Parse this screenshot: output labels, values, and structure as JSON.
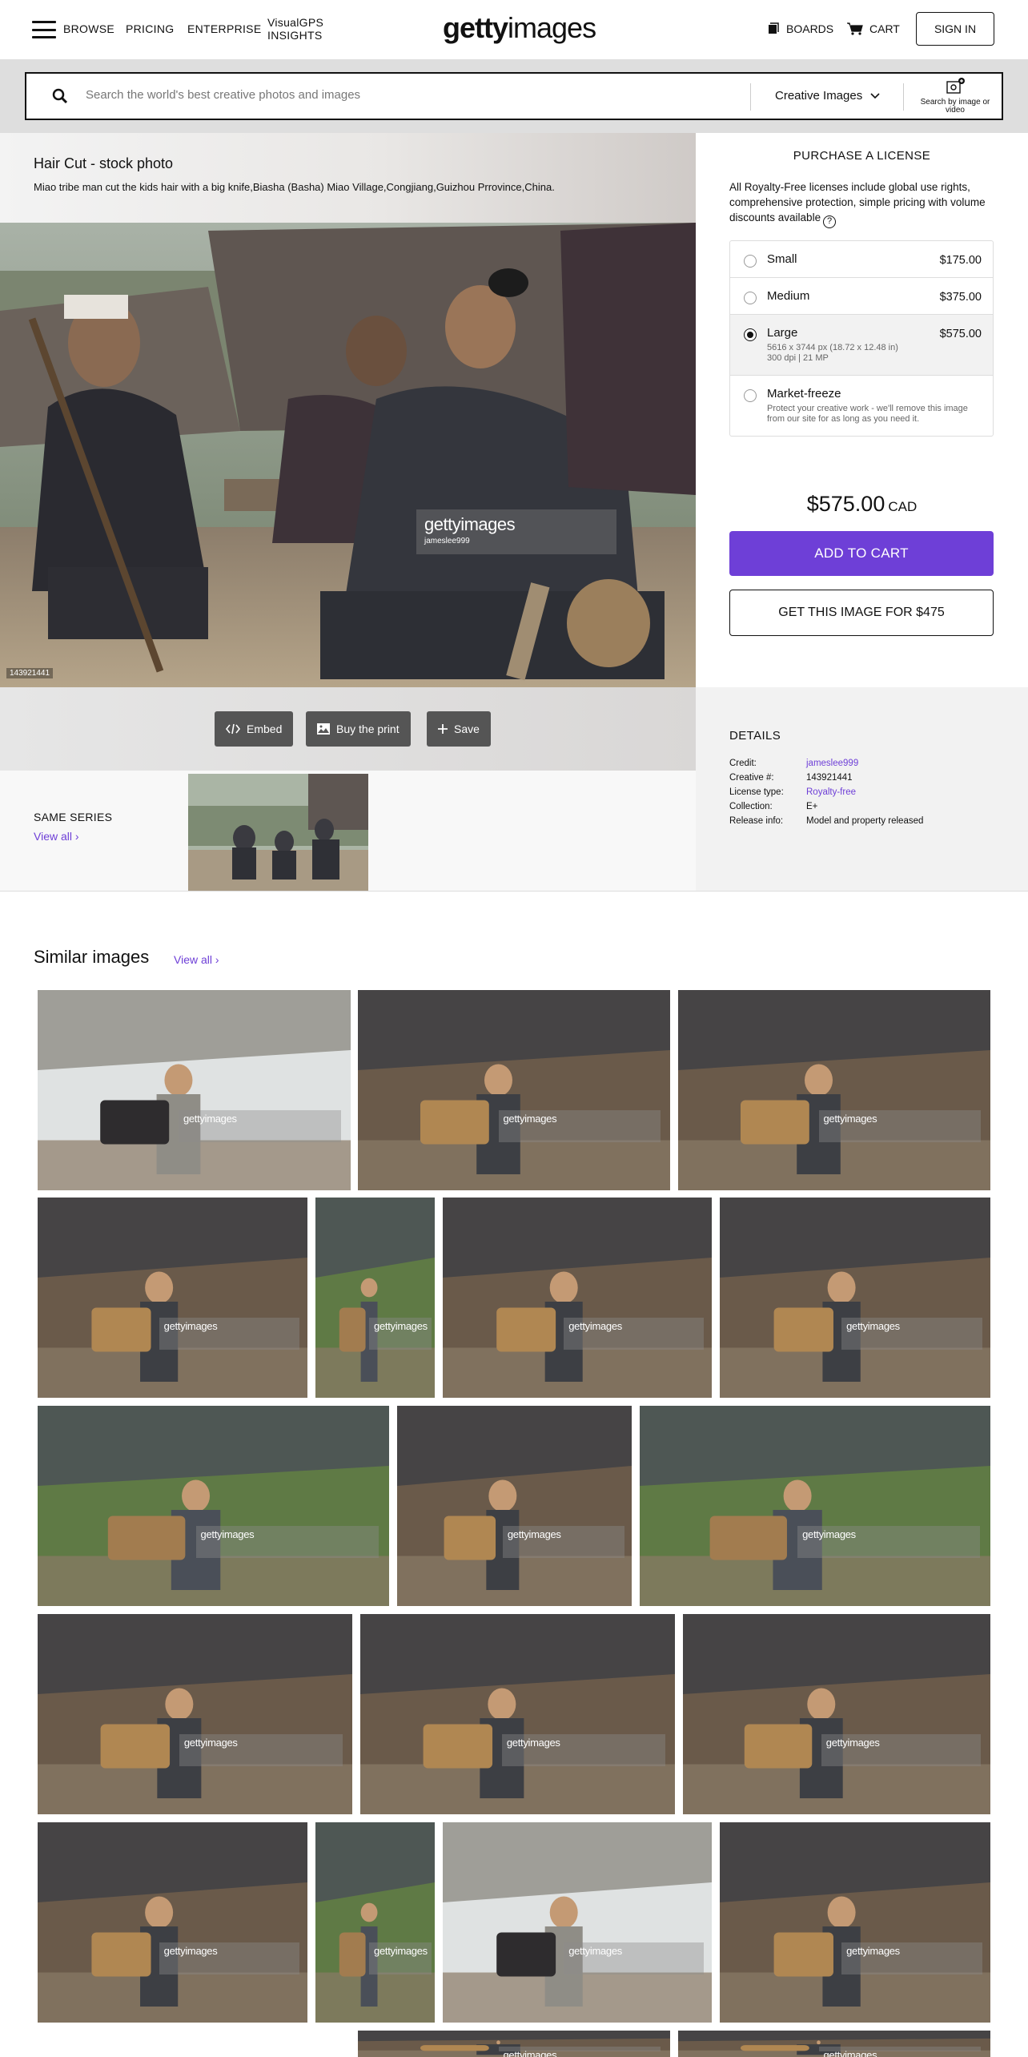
{
  "nav": {
    "browse": "BROWSE",
    "pricing": "PRICING",
    "enterprise": "ENTERPRISE",
    "insights": "VisualGPS INSIGHTS",
    "logo_bold": "getty",
    "logo_light": "images",
    "boards": "BOARDS",
    "cart": "CART",
    "signin": "SIGN IN"
  },
  "search": {
    "placeholder": "Search the world's best creative photos and images",
    "type": "Creative Images",
    "by_image": "Search by image or video"
  },
  "asset": {
    "title": "Hair Cut - stock photo",
    "caption": "Miao tribe man cut the kids hair with a big knife,Biasha (Basha) Miao Village,Congjiang,Guizhou Prrovince,China.",
    "id": "143921441",
    "watermark_logo": "gettyimages",
    "watermark_credit": "jameslee999"
  },
  "actions": {
    "embed": "Embed",
    "buy_print": "Buy the print",
    "save": "Save"
  },
  "license": {
    "title": "PURCHASE A LICENSE",
    "description": "All Royalty-Free licenses include global use rights, comprehensive protection, simple pricing with volume discounts available",
    "options": [
      {
        "name": "Small",
        "price": "$175.00",
        "sub": "",
        "selected": false
      },
      {
        "name": "Medium",
        "price": "$375.00",
        "sub": "",
        "selected": false
      },
      {
        "name": "Large",
        "price": "$575.00",
        "sub": "5616 x 3744 px (18.72 x 12.48 in)\n300 dpi | 21 MP",
        "selected": true
      },
      {
        "name": "Market-freeze",
        "price": "",
        "sub": "Protect your creative work - we'll remove this image from our site for as long as you need it.",
        "selected": false
      }
    ],
    "total": "$575.00",
    "currency": "CAD",
    "add_to_cart": "ADD TO CART",
    "get_image": "GET THIS IMAGE FOR $475"
  },
  "details": {
    "title": "DETAILS",
    "rows": [
      {
        "k": "Credit:",
        "v": "jameslee999",
        "link": true
      },
      {
        "k": "Creative #:",
        "v": "143921441",
        "link": false
      },
      {
        "k": "License type:",
        "v": "Royalty-free",
        "link": true
      },
      {
        "k": "Collection:",
        "v": "E+",
        "link": false
      },
      {
        "k": "Release info:",
        "v": "Model and property released",
        "link": false
      }
    ]
  },
  "series": {
    "title": "SAME SERIES",
    "view_all": "View all"
  },
  "similar": {
    "title": "Similar images",
    "view_all": "View all",
    "watermark": "gettyimages"
  },
  "colors": {
    "accent": "#6e3fd7",
    "dark": "#111111",
    "band": "#dedede"
  }
}
